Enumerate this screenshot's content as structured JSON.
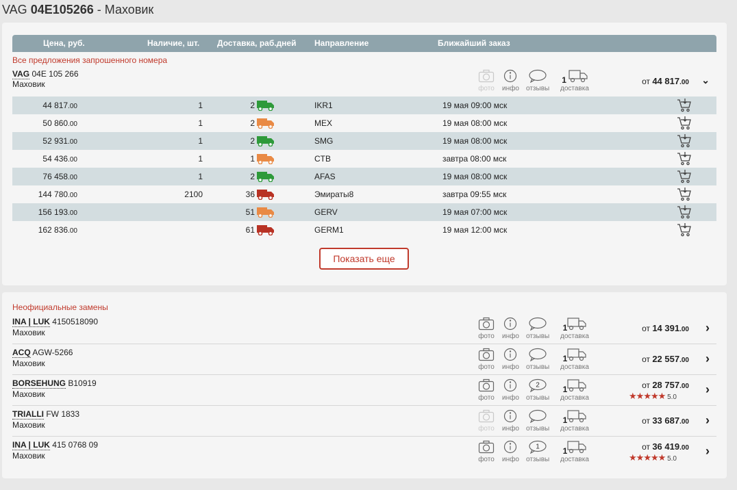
{
  "title": {
    "brand": "VAG",
    "number": "04E105266",
    "sep": " - ",
    "name": "Маховик"
  },
  "table_headers": {
    "price": "Цена, руб.",
    "qty": "Наличие, шт.",
    "delivery": "Доставка, раб.дней",
    "direction": "Направление",
    "order": "Ближайший заказ"
  },
  "section1_label": "Все предложения запрошенного номера",
  "product": {
    "brand": "VAG",
    "number": "04E 105 266",
    "name": "Маховик",
    "photo": "фото",
    "info": "инфо",
    "reviews": "отзывы",
    "delivery_count": "1",
    "delivery_label": "доставка",
    "from": "от",
    "price_int": "44 817",
    "price_dec": ".00"
  },
  "offers": [
    {
      "price": "44 817",
      "dec": ".00",
      "qty": "1",
      "days": "2",
      "truck": "#2e9a3a",
      "dir": "IKR1",
      "order": "19 мая 09:00 мск"
    },
    {
      "price": "50 860",
      "dec": ".00",
      "qty": "1",
      "days": "2",
      "truck": "#e98a45",
      "dir": "MEX",
      "order": "19 мая 08:00 мск"
    },
    {
      "price": "52 931",
      "dec": ".00",
      "qty": "1",
      "days": "2",
      "truck": "#2e9a3a",
      "dir": "SMG",
      "order": "19 мая 08:00 мск"
    },
    {
      "price": "54 436",
      "dec": ".00",
      "qty": "1",
      "days": "1",
      "truck": "#e98a45",
      "dir": "CTB",
      "order": "завтра 08:00 мск"
    },
    {
      "price": "76 458",
      "dec": ".00",
      "qty": "1",
      "days": "2",
      "truck": "#2e9a3a",
      "dir": "AFAS",
      "order": "19 мая 08:00 мск"
    },
    {
      "price": "144 780",
      "dec": ".00",
      "qty": "2100",
      "days": "36",
      "truck": "#b83224",
      "dir": "Эмираты8",
      "order": "завтра 09:55 мск"
    },
    {
      "price": "156 193",
      "dec": ".00",
      "qty": "",
      "days": "51",
      "truck": "#e98a45",
      "dir": "GERV",
      "order": "19 мая 07:00 мск"
    },
    {
      "price": "162 836",
      "dec": ".00",
      "qty": "",
      "days": "61",
      "truck": "#b83224",
      "dir": "GERM1",
      "order": "19 мая 12:00 мск"
    }
  ],
  "more_button": "Показать еще",
  "section2_label": "Неофициальные замены",
  "icon_labels": {
    "photo": "фото",
    "info": "инфо",
    "reviews": "отзывы",
    "delivery": "доставка",
    "from": "от"
  },
  "replacements": [
    {
      "brand": "INA | LUK",
      "number": "4150518090",
      "name": "Маховик",
      "photo_enabled": true,
      "reviews": "",
      "delivery": "1",
      "price": "14 391",
      "dec": ".00",
      "rating": ""
    },
    {
      "brand": "ACQ",
      "number": "AGW-5266",
      "name": "Маховик",
      "photo_enabled": true,
      "reviews": "",
      "delivery": "1",
      "price": "22 557",
      "dec": ".00",
      "rating": ""
    },
    {
      "brand": "BORSEHUNG",
      "number": "B10919",
      "name": "Маховик",
      "photo_enabled": true,
      "reviews": "2",
      "delivery": "1",
      "price": "28 757",
      "dec": ".00",
      "rating": "5.0"
    },
    {
      "brand": "TRIALLI",
      "number": "FW 1833",
      "name": "Маховик",
      "photo_enabled": false,
      "reviews": "",
      "delivery": "1",
      "price": "33 687",
      "dec": ".00",
      "rating": ""
    },
    {
      "brand": "INA | LUK",
      "number": "415 0768 09",
      "name": "Маховик",
      "photo_enabled": true,
      "reviews": "1",
      "delivery": "1",
      "price": "36 419",
      "dec": ".00",
      "rating": "5.0"
    }
  ]
}
